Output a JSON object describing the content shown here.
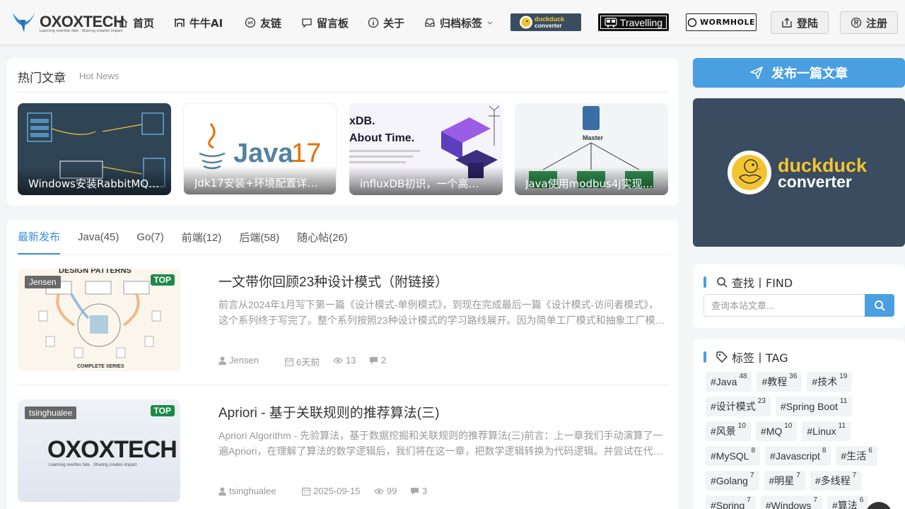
{
  "header": {
    "logo_text": "OXOXTECH",
    "logo_tagline": "Learning rewrites fate · Sharing creates impact",
    "nav": [
      {
        "label": "首页",
        "icon": "home-icon"
      },
      {
        "label": "牛牛AI",
        "icon": "bull-icon"
      },
      {
        "label": "友链",
        "icon": "link-icon"
      },
      {
        "label": "留言板",
        "icon": "message-icon"
      },
      {
        "label": "关于",
        "icon": "info-icon"
      },
      {
        "label": "归档标签",
        "icon": "archive-icon"
      }
    ],
    "badges": {
      "duck": "duckduck converter",
      "travel": "Travelling",
      "wormhole": "WORMHOLE"
    },
    "login": "登陆",
    "register": "注册"
  },
  "hot": {
    "title": "热门文章",
    "subtitle": "Hot News",
    "items": [
      {
        "caption": "Windows安装RabbitMQ…",
        "color": "#2f4454"
      },
      {
        "caption": "Jdk17安装+环境配置详…",
        "color": "#ffffff"
      },
      {
        "caption": "influxDB初识，一个高…",
        "color": "#f4f2fa"
      },
      {
        "caption": "Java使用modbus4j实现…",
        "color": "#d9dde2"
      }
    ],
    "image_text": {
      "java_label": "Java",
      "java_version": "17",
      "influx_line1": "xDB.",
      "influx_line2": "About Time.",
      "modbus_master": "Master"
    }
  },
  "list": {
    "tabs": [
      "最新发布",
      "Java(45)",
      "Go(7)",
      "前端(12)",
      "后端(58)",
      "随心帖(26)"
    ],
    "posts": [
      {
        "author_tag": "Jensen",
        "top": "TOP",
        "title": "一文带你回顾23种设计模式（附链接）",
        "excerpt": "前言从2024年1月写下第一篇《设计模式-单例模式》，到现在完成最后一篇《设计模式-访问者模式》，这个系列终于写完了。整个系列按照23种设计模式的学习路线展开。因为简单工厂模式和抽象工厂模…",
        "author": "Jensen",
        "date": "6天前",
        "views": "13",
        "comments": "2",
        "thumb_title": "DESIGN PATTERNS",
        "thumb_footer": "COMPLETE SERIES"
      },
      {
        "author_tag": "tsinghualee",
        "top": "TOP",
        "title": "Apriori - 基于关联规则的推荐算法(三)",
        "excerpt": "Apriori Algorithm - 先验算法，基于数据挖掘和关联规则的推荐算法(三)前言：上一章我们手动演算了一遍Apriori，在理解了算法的数学逻辑后，我们将在这一章，把数学逻辑转换为代码逻辑。并尝试在代…",
        "author": "tsinghualee",
        "date": "2025-09-15",
        "views": "99",
        "comments": "3",
        "thumb_title": "OXOXTECH",
        "thumb_sub": "Learning rewrites fate · Sharing creates impact"
      }
    ]
  },
  "sidebar": {
    "publish": "发布一篇文章",
    "ad": {
      "line1": "duckduck",
      "line2": "converter"
    },
    "search": {
      "title": "查找丨FIND",
      "placeholder": "查询本站文章..."
    },
    "tags": {
      "title": "标签丨TAG",
      "items": [
        {
          "name": "#Java",
          "count": "48"
        },
        {
          "name": "#教程",
          "count": "36"
        },
        {
          "name": "#技术",
          "count": "19"
        },
        {
          "name": "#设计模式",
          "count": "23"
        },
        {
          "name": "#Spring Boot",
          "count": "11"
        },
        {
          "name": "#风景",
          "count": "10"
        },
        {
          "name": "#MQ",
          "count": "10"
        },
        {
          "name": "#Linux",
          "count": "11"
        },
        {
          "name": "#MySQL",
          "count": "8"
        },
        {
          "name": "#Javascript",
          "count": "8"
        },
        {
          "name": "#生活",
          "count": "6"
        },
        {
          "name": "#Golang",
          "count": "7"
        },
        {
          "name": "#明星",
          "count": "7"
        },
        {
          "name": "#多线程",
          "count": "7"
        },
        {
          "name": "#Spring",
          "count": "7"
        },
        {
          "name": "#Windows",
          "count": "7"
        },
        {
          "name": "#算法",
          "count": "6"
        }
      ]
    }
  },
  "colors": {
    "accent": "#4a9fe0",
    "tab_active": "#3a90d9",
    "top_badge": "#1e8a4a"
  }
}
